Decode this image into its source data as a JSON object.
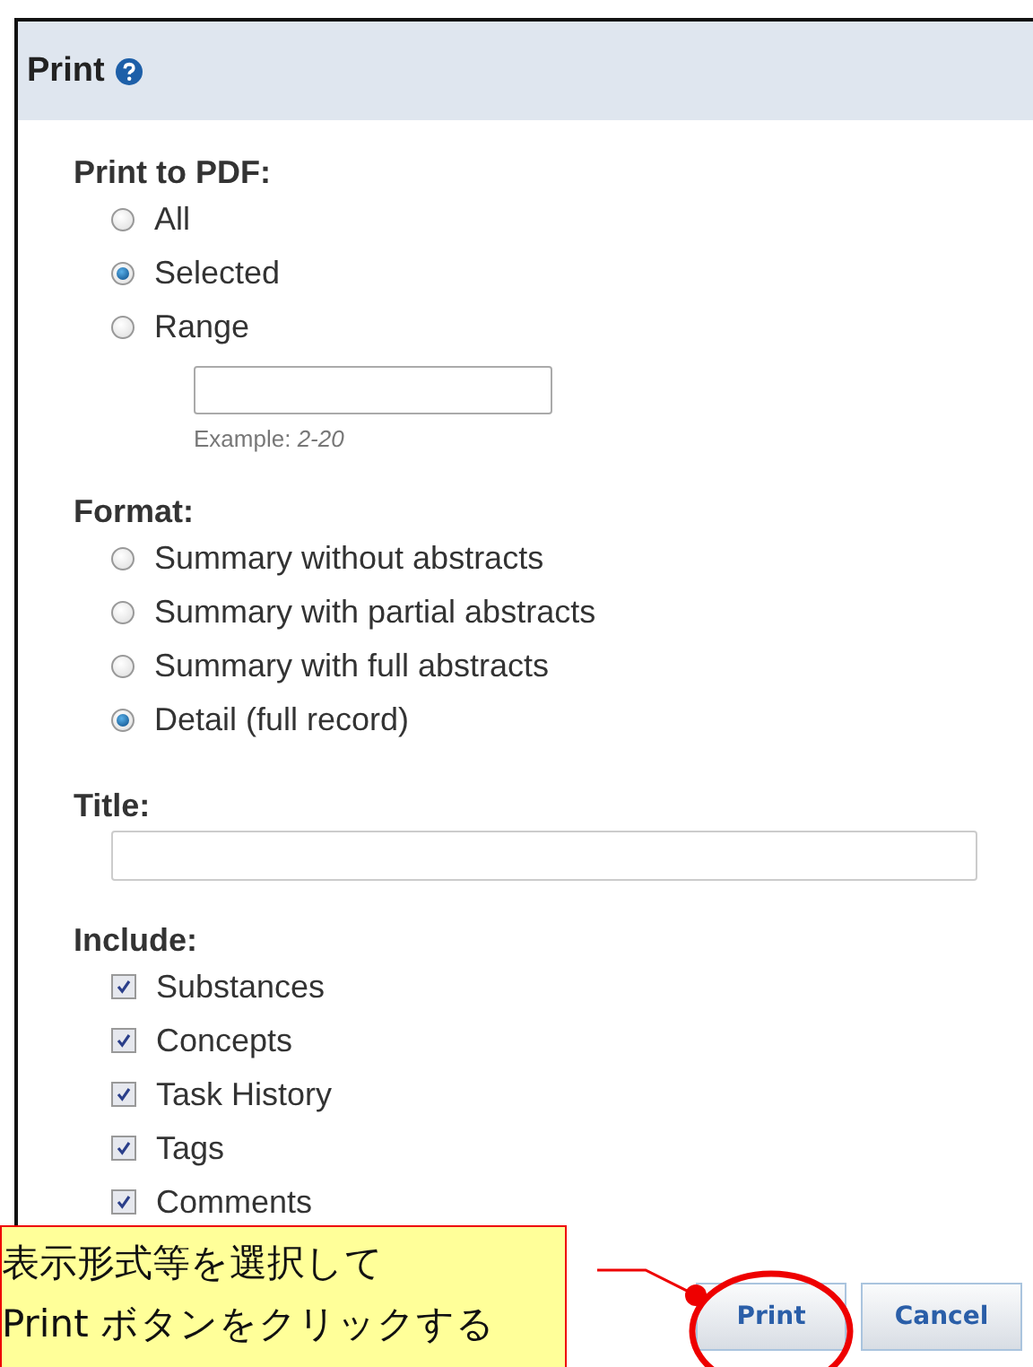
{
  "dialog": {
    "title": "Print"
  },
  "print_to_pdf": {
    "label": "Print to PDF:",
    "options": [
      {
        "label": "All",
        "selected": false
      },
      {
        "label": "Selected",
        "selected": true
      },
      {
        "label": "Range",
        "selected": false
      }
    ],
    "example": "Example: *2-20*"
  },
  "format": {
    "label": "Format:",
    "options": [
      {
        "label": "Summary without abstracts",
        "selected": false
      },
      {
        "label": "Summary with partial abstracts",
        "selected": false
      },
      {
        "label": "Summary with full abstracts",
        "selected": false
      },
      {
        "label": "Detail (full record)",
        "selected": true
      }
    ]
  },
  "title_field": {
    "label": "Title:"
  },
  "include": {
    "label": "Include:",
    "items": [
      {
        "label": "Substances",
        "checked": true
      },
      {
        "label": "Concepts",
        "checked": true
      },
      {
        "label": "Task History",
        "checked": true
      },
      {
        "label": "Tags",
        "checked": true
      },
      {
        "label": "Comments",
        "checked": true
      }
    ]
  },
  "buttons": [
    {
      "label": "Print",
      "kind": "primary"
    },
    {
      "label": "Cancel",
      "kind": "secondary"
    }
  ],
  "callout": {
    "text": "表示形式等を選択して\nPrint  ボタンをクリックする"
  }
}
